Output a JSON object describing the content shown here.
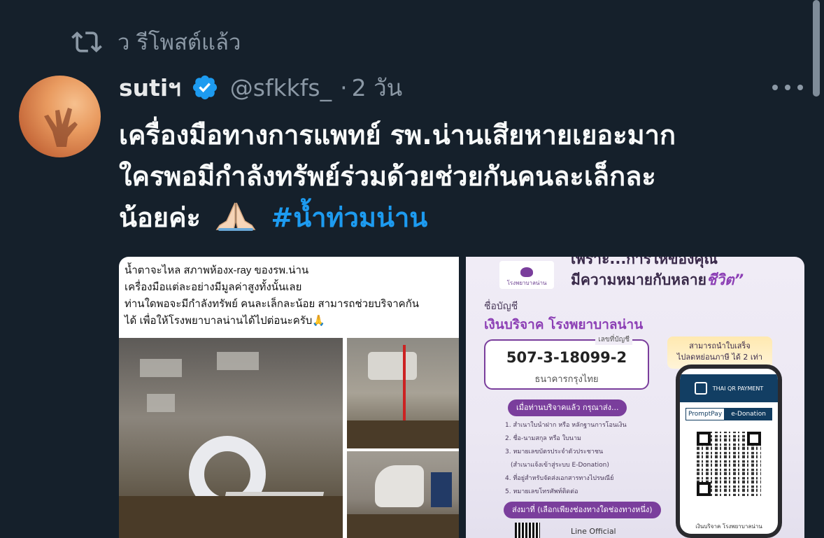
{
  "repost": {
    "label": "ว รีโพสต์แล้ว",
    "icon": "repost-icon"
  },
  "tweet": {
    "author_name": "sutiฯ",
    "handle": "@sfkkfs_",
    "separator": "·",
    "time": "2 วัน",
    "text_lines": [
      "เครื่องมือทางการแพทย์ รพ.น่านเสียหายเยอะมาก",
      "ใครพอมีกำลังทรัพย์ร่วมด้วยช่วยกันคนละเล็กละ",
      "น้อยค่ะ"
    ],
    "emoji": "folded-hands-icon",
    "hashtag": "#น้ำท่วมน่าน"
  },
  "media": {
    "left": {
      "caption_lines": [
        "น้ำตาจะไหล สภาพห้องx-ray ของรพ.น่าน",
        "เครื่องมือแต่ละอย่างมีมูลค่าสูงทั้งนั้นเลย",
        "ท่านใดพอจะมีกำลังทรัพย์ คนละเล็กละน้อย สามารถช่วยบริจาคกัน",
        "ได้ เพื่อให้โรงพยาบาลน่านได้ไปต่อนะครับ🙏"
      ]
    },
    "right": {
      "logo_text": "โรงพยาบาลน่าน",
      "slogan_line1": "เพราะ...การให้ของคุณ",
      "slogan_line2_prefix": "มีความหมายกับหลาย",
      "slogan_line2_accent": "ชีวิต”",
      "account_label": "ชื่อบัญชี",
      "account_name": "เงินบริจาค โรงพยาบาลน่าน",
      "account_number_label": "เลขที่บัญชี",
      "account_number": "507-3-18099-2",
      "bank": "ธนาคารกรุงไทย",
      "tax_line1": "สามารถนำใบเสร็จ",
      "tax_line2": "ไปลดหย่อนภาษี ได้ 2 เท่า",
      "after_donate": "เมื่อท่านบริจาคแล้ว กรุณาส่ง...",
      "steps": [
        "1. สำเนาใบนำฝาก หรือ หลักฐานการโอนเงิน",
        "2. ชื่อ-นามสกุล หรือ ใบนาม",
        "3. หมายเลขบัตรประจำตัวประชาชน",
        "(สำเนาแจ้งเข้าสู่ระบบ E-Donation)",
        "4. ที่อยู่สำหรับจัดส่งเอกสารทางไปรษณีย์",
        "5. หมายเลขโทรศัพท์ติดต่อ"
      ],
      "send_to": "ส่งมาที่ (เลือกเพียงช่องทางใดช่องทางหนึ่ง)",
      "line_official": "Line Official",
      "thai_qr": "THAI QR PAYMENT",
      "promptpay": "PromptPay",
      "edonation": "e-Donation",
      "phone_footer": "เงินบริจาค โรงพยาบาลน่าน"
    }
  },
  "colors": {
    "background": "#15202b",
    "hashtag": "#1d9bf0",
    "verified": "#1d9bf0",
    "muted": "#8b98a5"
  }
}
